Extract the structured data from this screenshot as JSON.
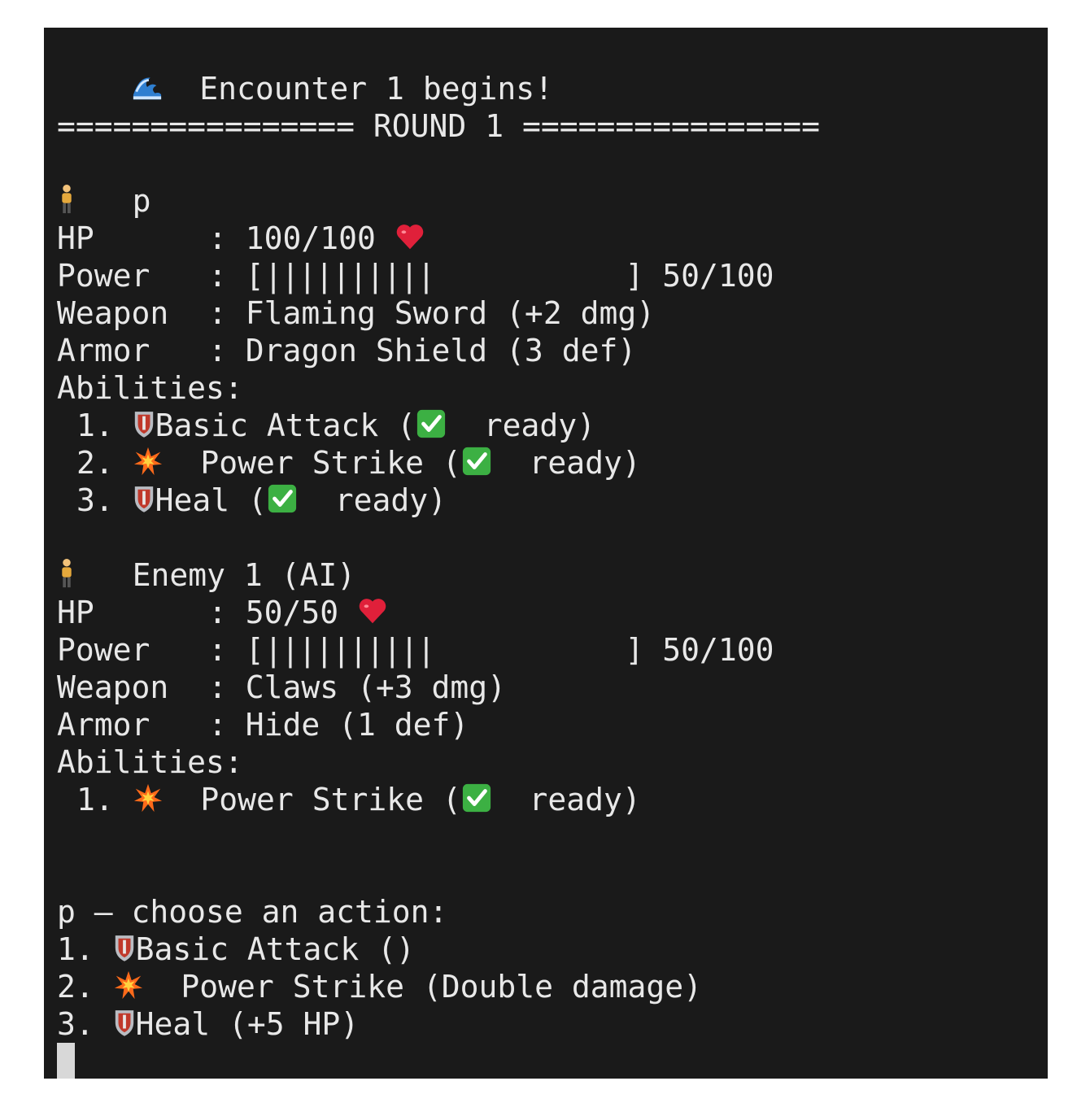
{
  "encounter": {
    "icon": "wave-icon",
    "text": "Encounter 1 begins!"
  },
  "round_banner": "================ ROUND 1 ================",
  "player": {
    "icon": "person-icon",
    "name": "p",
    "hp_label": "HP",
    "hp_value": "100/100",
    "hp_icon": "heart-icon",
    "power_label": "Power",
    "power_bar_open": "[",
    "power_bar_pipes": "||||||||||",
    "power_bar_close": "]",
    "power_value": "50/100",
    "power_fraction": 0.5,
    "weapon_label": "Weapon",
    "weapon_value": "Flaming Sword (+2 dmg)",
    "armor_label": "Armor",
    "armor_value": "Dragon Shield (3 def)",
    "abilities_label": "Abilities:",
    "abilities": [
      {
        "num": "1.",
        "icon": "shield-icon",
        "name": "Basic Attack",
        "status_icon": "check-icon",
        "status": "ready"
      },
      {
        "num": "2.",
        "icon": "burst-icon",
        "name": "Power Strike",
        "status_icon": "check-icon",
        "status": "ready"
      },
      {
        "num": "3.",
        "icon": "shield-icon",
        "name": "Heal",
        "status_icon": "check-icon",
        "status": "ready"
      }
    ]
  },
  "enemy": {
    "icon": "person-icon",
    "name": "Enemy 1 (AI)",
    "hp_label": "HP",
    "hp_value": "50/50",
    "hp_icon": "heart-icon",
    "power_label": "Power",
    "power_bar_open": "[",
    "power_bar_pipes": "||||||||||",
    "power_bar_close": "]",
    "power_value": "50/100",
    "power_fraction": 0.5,
    "weapon_label": "Weapon",
    "weapon_value": "Claws (+3 dmg)",
    "armor_label": "Armor",
    "armor_value": "Hide (1 def)",
    "abilities_label": "Abilities:",
    "abilities": [
      {
        "num": "1.",
        "icon": "burst-icon",
        "name": "Power Strike",
        "status_icon": "check-icon",
        "status": "ready"
      }
    ]
  },
  "prompt": {
    "text": "p — choose an action:",
    "options": [
      {
        "num": "1.",
        "icon": "shield-icon",
        "text": "Basic Attack ()"
      },
      {
        "num": "2.",
        "icon": "burst-icon",
        "text": "Power Strike (Double damage)"
      },
      {
        "num": "3.",
        "icon": "shield-icon",
        "text": "Heal (+5 HP)"
      }
    ]
  },
  "colors": {
    "background": "#1a1a1a",
    "text": "#e8e8e8",
    "heart": "#e0203a",
    "check": "#3cb043",
    "burst": "#ff6a1a"
  }
}
